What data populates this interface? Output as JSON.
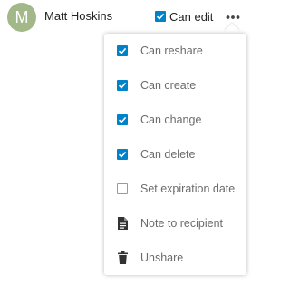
{
  "share": {
    "avatar_letter": "M",
    "user_name": "Matt Hoskins",
    "can_edit_label": "Can edit",
    "can_edit_checked": true
  },
  "menu": {
    "items": [
      {
        "label": "Can reshare",
        "type": "checkbox",
        "checked": true
      },
      {
        "label": "Can create",
        "type": "checkbox",
        "checked": true
      },
      {
        "label": "Can change",
        "type": "checkbox",
        "checked": true
      },
      {
        "label": "Can delete",
        "type": "checkbox",
        "checked": true
      },
      {
        "label": "Set expiration date",
        "type": "checkbox",
        "checked": false
      },
      {
        "label": "Note to recipient",
        "type": "icon",
        "icon": "note-icon"
      },
      {
        "label": "Unshare",
        "type": "icon",
        "icon": "trash-icon"
      }
    ]
  },
  "colors": {
    "accent": "#0082c9",
    "avatar": "#a3b889",
    "menu_text": "#6b6b6b",
    "icon": "#333333"
  }
}
